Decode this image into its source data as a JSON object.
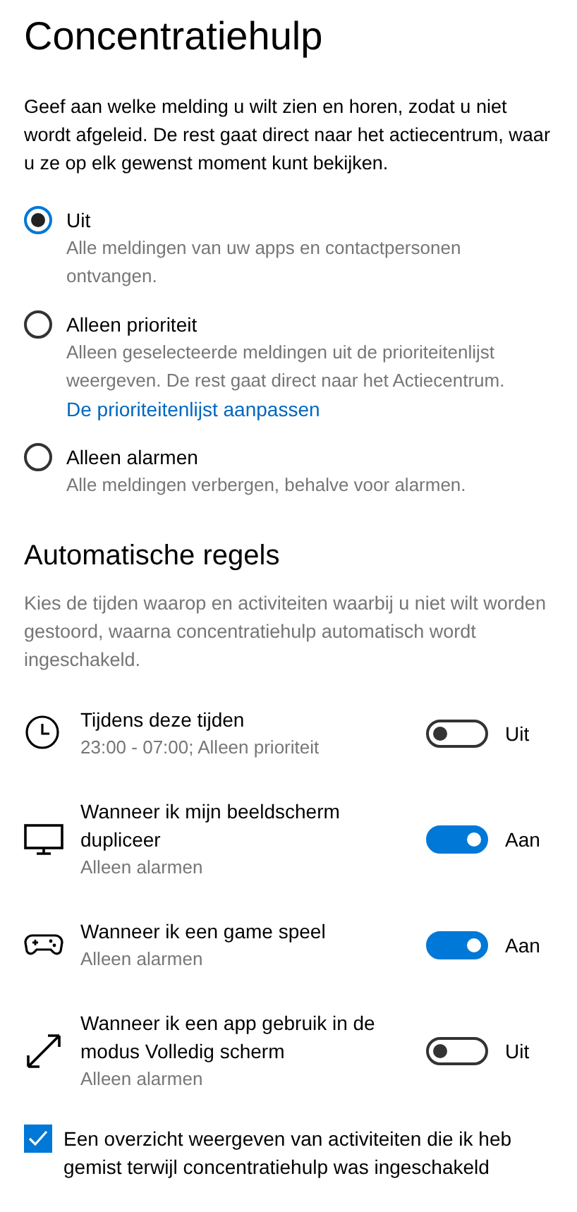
{
  "title": "Concentratiehulp",
  "description": "Geef aan welke melding u wilt zien en horen, zodat u niet wordt afgeleid. De rest gaat direct naar het actiecentrum, waar u ze op elk gewenst moment kunt bekijken.",
  "options": [
    {
      "label": "Uit",
      "description": "Alle meldingen van uw apps en contactpersonen ontvangen.",
      "selected": true
    },
    {
      "label": "Alleen prioriteit",
      "description": "Alleen geselecteerde meldingen uit de prioriteitenlijst weergeven. De rest gaat direct naar het Actiecentrum.",
      "link": "De prioriteitenlijst aanpassen",
      "selected": false
    },
    {
      "label": "Alleen alarmen",
      "description": "Alle meldingen verbergen, behalve voor alarmen.",
      "selected": false
    }
  ],
  "rules_heading": "Automatische regels",
  "rules_description": "Kies de tijden waarop en activiteiten waarbij u niet wilt worden gestoord, waarna concentratiehulp automatisch wordt ingeschakeld.",
  "rules": [
    {
      "title": "Tijdens deze tijden",
      "subtitle": "23:00 - 07:00; Alleen prioriteit",
      "on": false,
      "state_label": "Uit"
    },
    {
      "title": "Wanneer ik mijn beeldscherm dupliceer",
      "subtitle": "Alleen alarmen",
      "on": true,
      "state_label": "Aan"
    },
    {
      "title": "Wanneer ik een game speel",
      "subtitle": "Alleen alarmen",
      "on": true,
      "state_label": "Aan"
    },
    {
      "title": "Wanneer ik een app gebruik in de modus Volledig scherm",
      "subtitle": "Alleen alarmen",
      "on": false,
      "state_label": "Uit"
    }
  ],
  "summary_checkbox": {
    "label": "Een overzicht weergeven van activiteiten die ik heb gemist terwijl concentratiehulp was ingeschakeld",
    "checked": true
  }
}
